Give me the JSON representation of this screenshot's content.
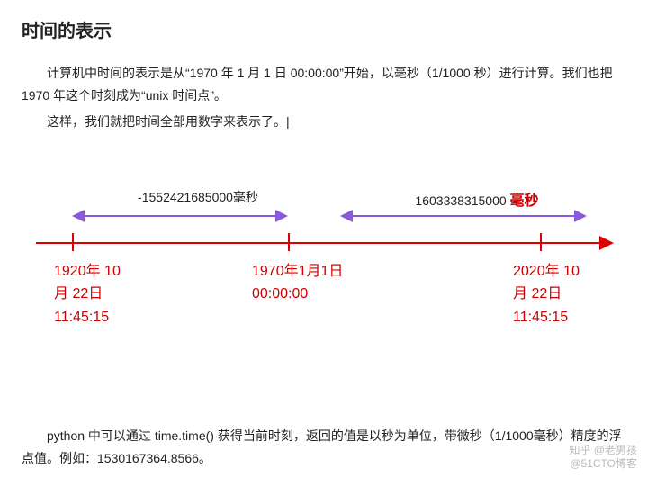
{
  "title": "时间的表示",
  "para1": "计算机中时间的表示是从“1970 年 1 月 1 日 00:00:00”开始，以毫秒（1/1000 秒）进行计算。我们也把 1970 年这个时刻成为“unix 时间点”。",
  "para2": "这样，我们就把时间全部用数字来表示了。|",
  "timeline": {
    "left_ms": "-1552421685000毫秒",
    "right_ms_num": "1603338315000",
    "right_ms_unit": "毫秒",
    "date1_l1": "1920年 10",
    "date1_l2": "月 22日",
    "date1_l3": "11:45:15",
    "date2_l1": "1970年1月1日",
    "date2_l2": "00:00:00",
    "date3_l1": "2020年 10",
    "date3_l2": "月 22日",
    "date3_l3": "11:45:15"
  },
  "footer_text": "python 中可以通过 time.time() 获得当前时刻，返回的值是以秒为单位，带微秒（1/1000毫秒）精度的浮点值。例如：1530167364.8566。",
  "watermark_l1": "知乎 @老男孩",
  "watermark_l2": "@51CTO博客"
}
